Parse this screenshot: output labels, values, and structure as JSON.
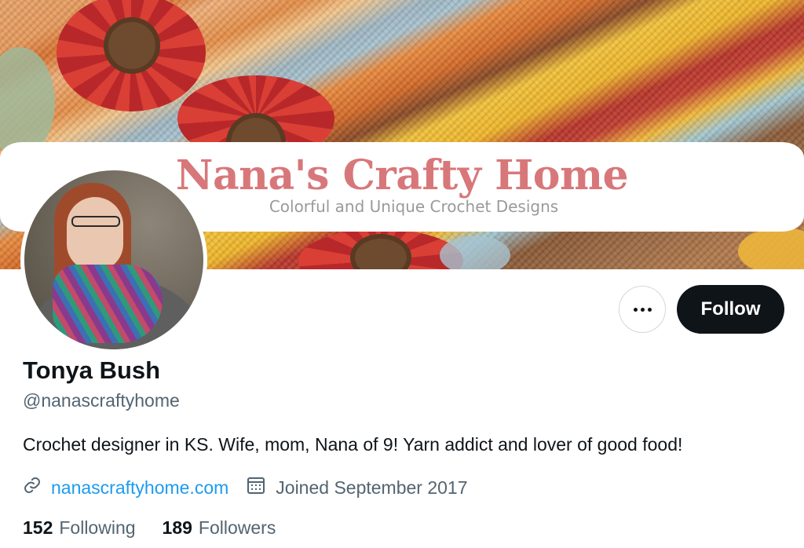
{
  "banner": {
    "title": "Nana's Crafty Home",
    "tagline": "Colorful and Unique Crochet Designs"
  },
  "profile": {
    "display_name": "Tonya Bush",
    "handle": "@nanascraftyhome",
    "bio": "Crochet designer in KS. Wife, mom, Nana of 9! Yarn addict and lover of good food!",
    "website": "nanascraftyhome.com",
    "website_icon": "link-icon",
    "joined": "Joined September 2017",
    "joined_icon": "calendar-icon"
  },
  "actions": {
    "more_icon": "more-options-icon",
    "follow_label": "Follow"
  },
  "stats": {
    "following_count": "152",
    "following_label": "Following",
    "followers_count": "189",
    "followers_label": "Followers"
  },
  "colors": {
    "primary_text": "#0f1419",
    "secondary_text": "#536471",
    "link": "#1d9bf0",
    "follow_button_bg": "#0f1419",
    "banner_title": "#d8777a"
  }
}
